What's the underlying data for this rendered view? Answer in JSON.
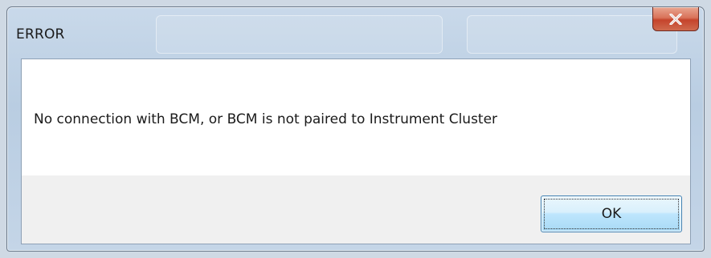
{
  "dialog": {
    "title": "ERROR",
    "message": "No connection with BCM, or BCM is not paired to Instrument Cluster",
    "ok_label": "OK",
    "close_icon": "close-icon"
  },
  "colors": {
    "close_button": "#c5442c",
    "ok_button_border": "#3c7fb1",
    "message_background": "#ffffff",
    "footer_background": "#f0f0f0"
  }
}
